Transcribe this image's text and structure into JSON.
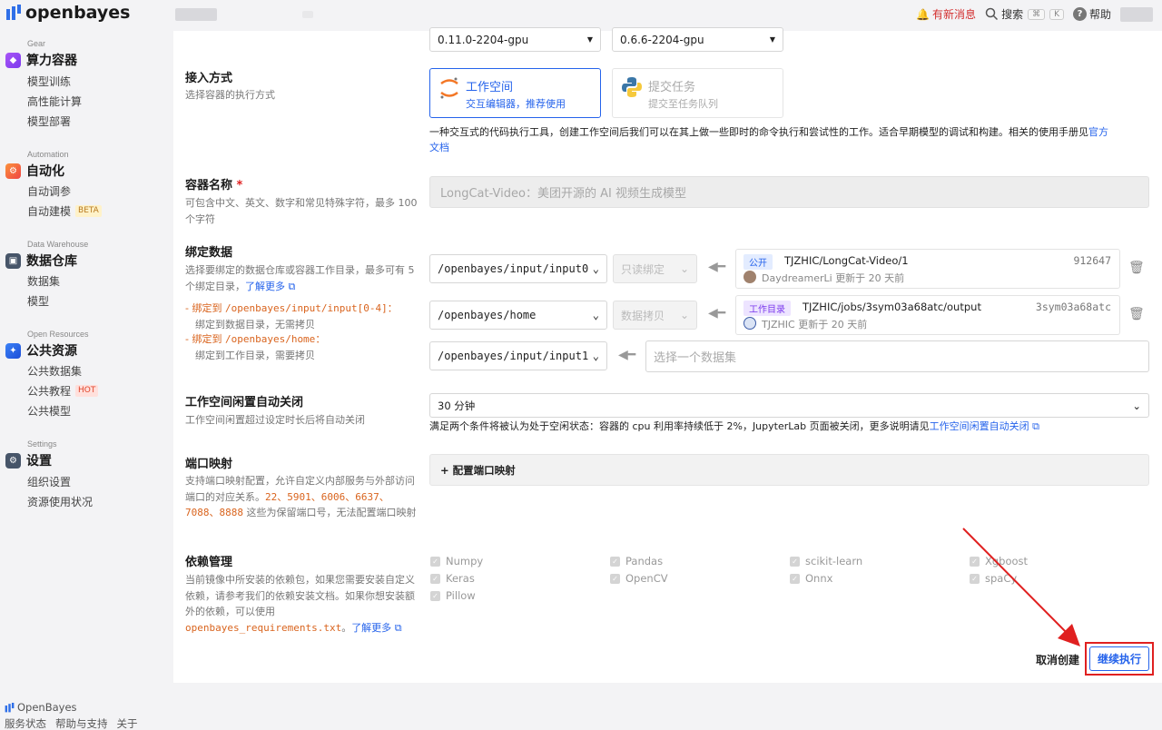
{
  "topbar": {
    "brand": "openbayes",
    "notification": "有新消息",
    "search": "搜索",
    "search_keys": [
      "⌘",
      "K"
    ],
    "help": "帮助"
  },
  "sidebar": {
    "sections": [
      {
        "small": "Gear",
        "title": "算力容器",
        "icon": "gear-box-icon",
        "items": [
          {
            "label": "模型训练"
          },
          {
            "label": "高性能计算"
          },
          {
            "label": "模型部署"
          }
        ]
      },
      {
        "small": "Automation",
        "title": "自动化",
        "icon": "automation-icon",
        "items": [
          {
            "label": "自动调参"
          },
          {
            "label": "自动建模",
            "tag": "BETA"
          }
        ]
      },
      {
        "small": "Data Warehouse",
        "title": "数据仓库",
        "icon": "warehouse-icon",
        "items": [
          {
            "label": "数据集"
          },
          {
            "label": "模型"
          }
        ]
      },
      {
        "small": "Open Resources",
        "title": "公共资源",
        "icon": "resources-icon",
        "items": [
          {
            "label": "公共数据集"
          },
          {
            "label": "公共教程",
            "tag": "HOT"
          },
          {
            "label": "公共模型"
          }
        ]
      },
      {
        "small": "Settings",
        "title": "设置",
        "icon": "settings-icon",
        "items": [
          {
            "label": "组织设置"
          },
          {
            "label": "资源使用状况"
          }
        ]
      }
    ]
  },
  "footer": {
    "brand": "OpenBayes",
    "links": [
      "服务状态",
      "帮助与支持",
      "关于"
    ]
  },
  "form": {
    "version_selects": [
      "0.11.0-2204-gpu",
      "0.6.6-2204-gpu"
    ],
    "access": {
      "label": "接入方式",
      "desc": "选择容器的执行方式",
      "options": [
        {
          "title": "工作空间",
          "sub": "交互编辑器，推荐使用"
        },
        {
          "title": "提交任务",
          "sub": "提交至任务队列"
        }
      ],
      "note": "一种交互式的代码执行工具，创建工作空间后我们可以在其上做一些即时的命令执行和尝试性的工作。适合早期模型的调试和构建。相关的使用手册见",
      "note_link1": "官方",
      "note_link2": "文档"
    },
    "name": {
      "label": "容器名称",
      "required": "*",
      "desc": "可包含中文、英文、数字和常见特殊字符，最多 100 个字符",
      "value": "LongCat-Video：美团开源的 AI 视频生成模型"
    },
    "binding": {
      "label": "绑定数据",
      "desc": "选择要绑定的数据仓库或容器工作目录，最多可有 5 个绑定目录，",
      "learn_more": "了解更多",
      "rule1_prefix": "- 绑定到 ",
      "rule1_path": "/openbayes/input/input[0-4]",
      "rule1_suffix": "：",
      "rule1_desc": "绑定到数据目录，无需拷贝",
      "rule2_prefix": "- 绑定到 ",
      "rule2_path": "/openbayes/home",
      "rule2_suffix": "：",
      "rule2_desc": "绑定到工作目录，需要拷贝",
      "rows": [
        {
          "path": "/openbayes/input/input0",
          "mode": "只读绑定",
          "badge": "公开",
          "name": "TJZHIC/LongCat-Video/1",
          "id": "912647",
          "user": "DaydreamerLi",
          "updated": "更新于 20 天前"
        },
        {
          "path": "/openbayes/home",
          "mode": "数据拷贝",
          "badge": "工作目录",
          "name": "TJZHIC/jobs/3sym03a68atc/output",
          "id": "3sym03a68atc",
          "user": "TJZHIC",
          "updated": "更新于 20 天前"
        },
        {
          "path": "/openbayes/input/input1",
          "placeholder": "选择一个数据集"
        }
      ]
    },
    "idle": {
      "label": "工作空间闲置自动关闭",
      "desc": "工作空间闲置超过设定时长后将自动关闭",
      "value": "30 分钟",
      "note": "满足两个条件将被认为处于空闲状态：容器的 cpu 利用率持续低于 2%，JupyterLab 页面被关闭，更多说明请见",
      "note_link": "工作空间闲置自动关闭"
    },
    "ports": {
      "label": "端口映射",
      "desc_pre": "支持端口映射配置，允许自定义内部服务与外部访问端口的对应关系。",
      "ports_list": "22、5901、6006、6637、7088、8888",
      "desc_post": " 这些为保留端口号，无法配置端口映射",
      "button": "+ 配置端口映射"
    },
    "deps": {
      "label": "依赖管理",
      "desc": "当前镜像中所安装的依赖包，如果您需要安装自定义依赖，请参考我们的依赖安装文档。如果你想安装额外的依赖，可以使用",
      "file": "openbayes_requirements.txt",
      "sep": "。",
      "learn_more": "了解更多",
      "packages": [
        "Numpy",
        "Pandas",
        "scikit-learn",
        "Xgboost",
        "Keras",
        "OpenCV",
        "Onnx",
        "spaCy",
        "Pillow"
      ]
    },
    "actions": {
      "cancel": "取消创建",
      "submit": "继续执行"
    }
  },
  "colors": {
    "accent": "#2563eb",
    "highlight": "#e02020",
    "warn": "#d9641e"
  }
}
